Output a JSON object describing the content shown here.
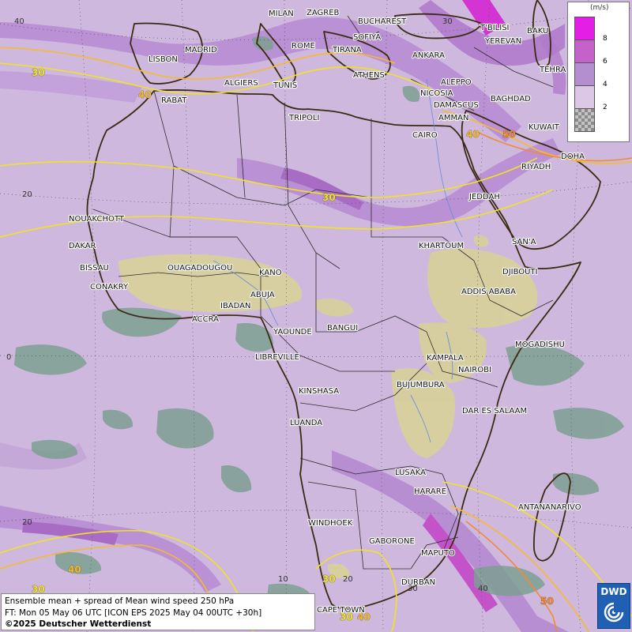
{
  "map": {
    "title": "Ensemble mean + spread of Mean wind speed 250 hPa",
    "forecast_time": "FT: Mon 05 May 06 UTC [ICON EPS 2025 May 04 00UTC +30h]",
    "copyright": "©2025 Deutscher Wetterdienst",
    "logo_text": "DWD",
    "legend": {
      "unit": "(m/s)",
      "ticks": [
        "8",
        "6",
        "4",
        "2"
      ],
      "colors": [
        "#e51ee5",
        "#c462c9",
        "#b48fd0",
        "#dcc8e6",
        "#9b9b9b"
      ]
    },
    "colors": {
      "background": "#cfb8de",
      "spread_fill": "#7d9f92",
      "terrain_fill": "#d8d19a",
      "coast": "#3b2a12",
      "contour_30": "#f0e224",
      "contour_40": "#f4bb2d",
      "contour_50": "#f28a35"
    },
    "coord_labels": [
      "40",
      "20",
      "20",
      "0",
      "10",
      "20",
      "30",
      "40",
      "30",
      "20"
    ],
    "contour_labels": [
      "30",
      "40",
      "30",
      "40",
      "50",
      "30",
      "40",
      "30",
      "30",
      "40",
      "50"
    ],
    "cities": [
      "MILAN",
      "ZAGREB",
      "BUCHAREST",
      "T'BILISI",
      "BAKU",
      "SOFIYA",
      "YEREVAN",
      "MADRID",
      "ROME",
      "TIRANA",
      "ANKARA",
      "TEHRA",
      "LISBON",
      "ATHENS",
      "ALGIERS",
      "TUNIS",
      "ALEPPO",
      "RABAT",
      "NICOSIA",
      "BAGHDAD",
      "DAMASCUS",
      "AMMAN",
      "TRIPOLI",
      "KUWAIT",
      "CAIRO",
      "DOHA",
      "RIYADH",
      "JEDDAH",
      "NOUAKCHOTT",
      "SAN'A",
      "KHARTOUM",
      "DAKAR",
      "DJIBOUTI",
      "BISSAU",
      "OUAGADOUGOU",
      "KANO",
      "CONAKRY",
      "ADDIS ABABA",
      "ABUJA",
      "IBADAN",
      "ACCRA",
      "YAOUNDE",
      "BANGUI",
      "MOGADISHU",
      "LIBREVILLE",
      "KAMPALA",
      "NAIROBI",
      "KINSHASA",
      "BUJUMBURA",
      "DAR ES SALAAM",
      "LUANDA",
      "LUSAKA",
      "HARARE",
      "ANTANANARIVO",
      "WINDHOEK",
      "GABORONE",
      "MAPUTO",
      "DURBAN",
      "CAPE TOWN"
    ]
  }
}
